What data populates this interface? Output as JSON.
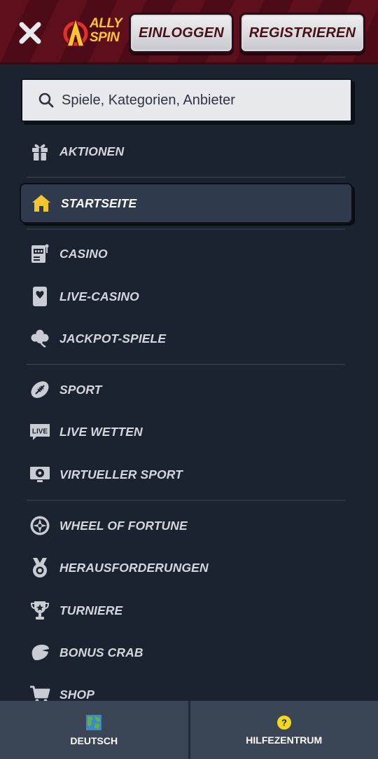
{
  "header": {
    "logo_line1": "ALLY",
    "logo_line2": "SPIN",
    "login_label": "EINLOGGEN",
    "register_label": "REGISTRIEREN"
  },
  "search": {
    "placeholder": "Spiele, Kategorien, Anbieter"
  },
  "menu": {
    "items": [
      {
        "label": "AKTIONEN",
        "icon": "gift-icon"
      },
      {
        "label": "STARTSEITE",
        "icon": "home-icon",
        "active": true
      },
      {
        "label": "CASINO",
        "icon": "slot-machine-icon"
      },
      {
        "label": "LIVE-CASINO",
        "icon": "playing-card-icon"
      },
      {
        "label": "JACKPOT-SPIELE",
        "icon": "clover-icon"
      },
      {
        "label": "SPORT",
        "icon": "football-icon"
      },
      {
        "label": "LIVE WETTEN",
        "icon": "live-icon"
      },
      {
        "label": "VIRTUELLER SPORT",
        "icon": "monitor-ball-icon"
      },
      {
        "label": "WHEEL OF FORTUNE",
        "icon": "wheel-icon"
      },
      {
        "label": "HERAUSFORDERUNGEN",
        "icon": "medal-icon"
      },
      {
        "label": "TURNIERE",
        "icon": "trophy-icon"
      },
      {
        "label": "BONUS CRAB",
        "icon": "crab-claw-icon"
      },
      {
        "label": "SHOP",
        "icon": "cart-icon"
      }
    ],
    "live_badge": "LIVE"
  },
  "footer": {
    "language_label": "DEUTSCH",
    "help_label": "HILFEZENTRUM",
    "help_icon_glyph": "?"
  },
  "colors": {
    "accent_yellow": "#f7c531",
    "header_red": "#5e0f1c",
    "background": "#1b2230",
    "active_item": "#2f3b4d"
  }
}
